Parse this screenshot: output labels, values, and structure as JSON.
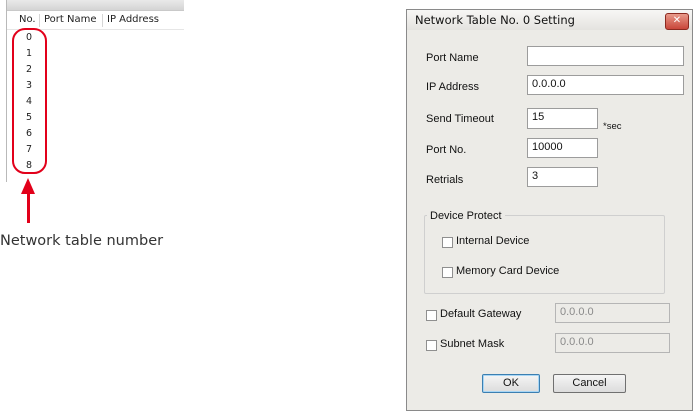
{
  "table_list": {
    "columns": [
      "No.",
      "Port Name",
      "IP Address"
    ],
    "rows": [
      "0",
      "1",
      "2",
      "3",
      "4",
      "5",
      "6",
      "7",
      "8"
    ]
  },
  "annotation": {
    "caption": "Network table number",
    "accent_color": "#e2001a"
  },
  "dialog": {
    "title": "Network Table No. 0 Setting",
    "close_glyph": "✕",
    "port_name": {
      "label": "Port Name",
      "value": ""
    },
    "ip_address": {
      "label": "IP Address",
      "value": "0.0.0.0"
    },
    "send_timeout": {
      "label": "Send Timeout",
      "value": "15",
      "unit": "*sec"
    },
    "port_no": {
      "label": "Port No.",
      "value": "10000"
    },
    "retrials": {
      "label": "Retrials",
      "value": "3"
    },
    "device_protect": {
      "title": "Device Protect",
      "internal_device": {
        "label": "Internal Device",
        "checked": false
      },
      "memory_card_device": {
        "label": "Memory Card Device",
        "checked": false
      }
    },
    "default_gateway": {
      "label": "Default Gateway",
      "value": "0.0.0.0",
      "checked": false
    },
    "subnet_mask": {
      "label": "Subnet Mask",
      "value": "0.0.0.0",
      "checked": false
    },
    "ok_label": "OK",
    "cancel_label": "Cancel"
  }
}
